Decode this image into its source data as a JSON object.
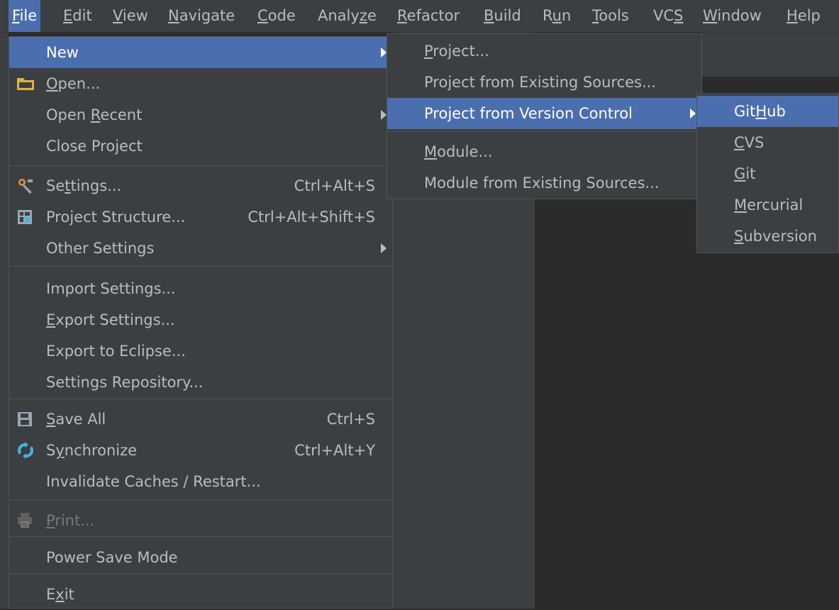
{
  "menubar": {
    "items": [
      {
        "pre": "",
        "mn": "F",
        "post": "ile"
      },
      {
        "pre": "",
        "mn": "E",
        "post": "dit"
      },
      {
        "pre": "",
        "mn": "V",
        "post": "iew"
      },
      {
        "pre": "",
        "mn": "N",
        "post": "avigate"
      },
      {
        "pre": "",
        "mn": "C",
        "post": "ode"
      },
      {
        "pre": "Analy",
        "mn": "z",
        "post": "e"
      },
      {
        "pre": "",
        "mn": "R",
        "post": "efactor"
      },
      {
        "pre": "",
        "mn": "B",
        "post": "uild"
      },
      {
        "pre": "R",
        "mn": "u",
        "post": "n"
      },
      {
        "pre": "",
        "mn": "T",
        "post": "ools"
      },
      {
        "pre": "VC",
        "mn": "S",
        "post": ""
      },
      {
        "pre": "",
        "mn": "W",
        "post": "indow"
      },
      {
        "pre": "",
        "mn": "H",
        "post": "elp"
      }
    ]
  },
  "file_menu": {
    "items": [
      {
        "pre": "New",
        "mn": "",
        "post": ""
      },
      {
        "pre": "",
        "mn": "O",
        "post": "pen..."
      },
      {
        "pre": "Open ",
        "mn": "R",
        "post": "ecent"
      },
      {
        "pre": "Close Pro",
        "mn": "j",
        "post": "ect"
      },
      {
        "pre": "Se",
        "mn": "t",
        "post": "tings...",
        "shortcut": "Ctrl+Alt+S"
      },
      {
        "pre": "Project Structure...",
        "mn": "",
        "post": "",
        "shortcut": "Ctrl+Alt+Shift+S"
      },
      {
        "pre": "Other Settings",
        "mn": "",
        "post": ""
      },
      {
        "pre": "Import Settings...",
        "mn": "",
        "post": ""
      },
      {
        "pre": "",
        "mn": "E",
        "post": "xport Settings..."
      },
      {
        "pre": "Export to Eclipse...",
        "mn": "",
        "post": ""
      },
      {
        "pre": "Settings Repository...",
        "mn": "",
        "post": ""
      },
      {
        "pre": "",
        "mn": "S",
        "post": "ave All",
        "shortcut": "Ctrl+S"
      },
      {
        "pre": "S",
        "mn": "y",
        "post": "nchronize",
        "shortcut": "Ctrl+Alt+Y"
      },
      {
        "pre": "Invalidate Caches / Restart...",
        "mn": "",
        "post": ""
      },
      {
        "pre": "",
        "mn": "P",
        "post": "rint..."
      },
      {
        "pre": "Power Save Mode",
        "mn": "",
        "post": ""
      },
      {
        "pre": "E",
        "mn": "x",
        "post": "it"
      }
    ]
  },
  "new_submenu": {
    "items": [
      {
        "pre": "",
        "mn": "P",
        "post": "roject..."
      },
      {
        "pre": "Project from Existing Sources...",
        "mn": "",
        "post": ""
      },
      {
        "pre": "Project from Version Control",
        "mn": "",
        "post": ""
      },
      {
        "pre": "",
        "mn": "M",
        "post": "odule..."
      },
      {
        "pre": "Module from Existing Sources...",
        "mn": "",
        "post": ""
      }
    ]
  },
  "vcs_submenu": {
    "items": [
      {
        "pre": "Git",
        "mn": "H",
        "post": "ub"
      },
      {
        "pre": "",
        "mn": "C",
        "post": "VS"
      },
      {
        "pre": "",
        "mn": "G",
        "post": "it"
      },
      {
        "pre": "",
        "mn": "M",
        "post": "ercurial"
      },
      {
        "pre": "",
        "mn": "S",
        "post": "ubversion"
      }
    ]
  }
}
